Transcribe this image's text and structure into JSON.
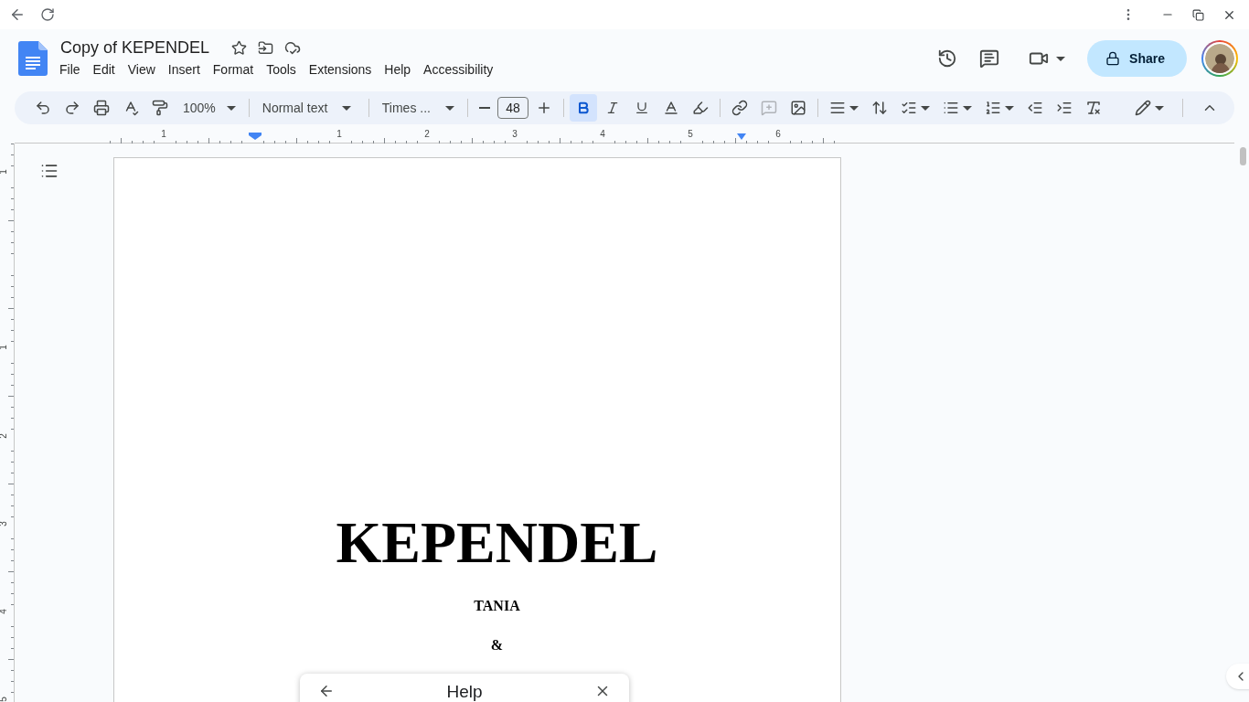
{
  "document": {
    "title": "Copy of KEPENDEL"
  },
  "menu": [
    {
      "label": "File"
    },
    {
      "label": "Edit"
    },
    {
      "label": "View"
    },
    {
      "label": "Insert"
    },
    {
      "label": "Format"
    },
    {
      "label": "Tools"
    },
    {
      "label": "Extensions"
    },
    {
      "label": "Help"
    },
    {
      "label": "Accessibility"
    }
  ],
  "share": {
    "label": "Share"
  },
  "toolbar": {
    "zoom": "100%",
    "style": "Normal text",
    "font": "Times ...",
    "font_size": "48",
    "format_buttons": [
      {
        "kind": "bold",
        "selected": true
      },
      {
        "kind": "italic",
        "selected": false
      },
      {
        "kind": "underline",
        "selected": false
      }
    ]
  },
  "ruler": {
    "horizontal": [
      "1",
      "1",
      "2",
      "3",
      "4",
      "5",
      "6"
    ],
    "vertical": [
      "1",
      "1",
      "2",
      "3",
      "4",
      "5"
    ]
  },
  "page": {
    "paragraphs": [
      {
        "kind": "title",
        "text": "KEPENDEL"
      },
      {
        "kind": "name",
        "text": "TANIA"
      },
      {
        "kind": "name",
        "text": "&"
      }
    ]
  },
  "help_panel": {
    "title": "Help"
  }
}
